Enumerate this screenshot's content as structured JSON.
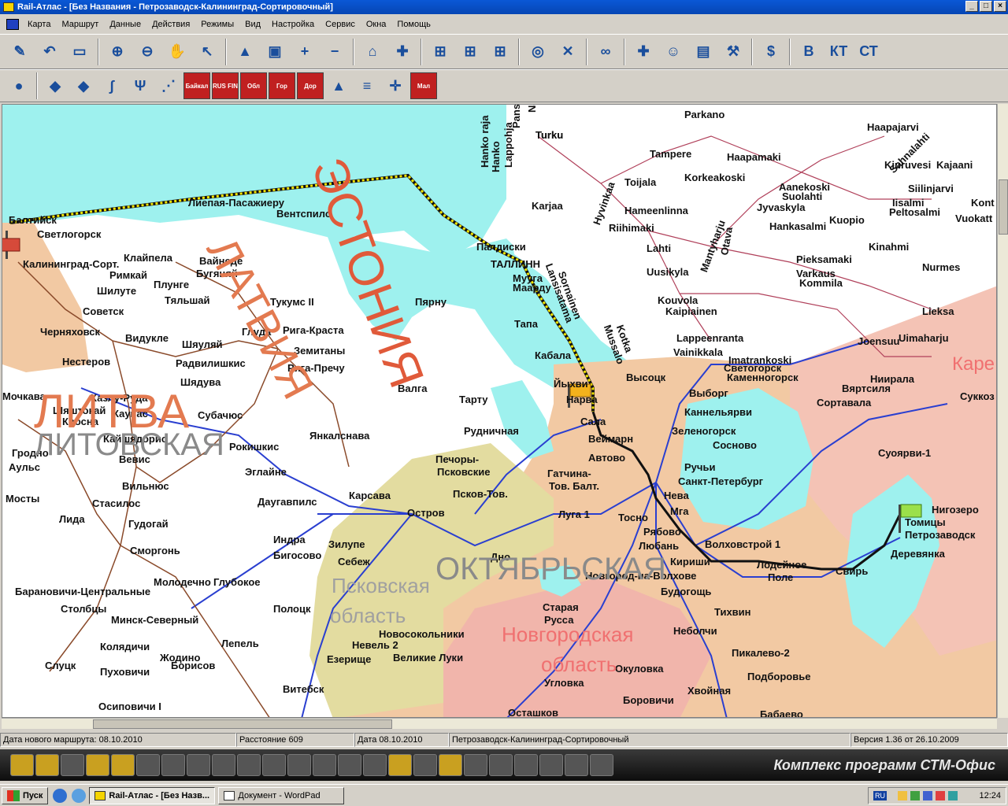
{
  "window": {
    "title": "Rail-Атлас - [Без Названия   -   Петрозаводск-Калининград-Сортировочный]",
    "controls": {
      "minimize": "_",
      "maximize": "□",
      "close": "×"
    }
  },
  "menu": [
    "Карта",
    "Маршрут",
    "Данные",
    "Действия",
    "Режимы",
    "Вид",
    "Настройка",
    "Сервис",
    "Окна",
    "Помощь"
  ],
  "toolbar1": [
    {
      "icon": "edit-pencil-icon",
      "glyph": "✎"
    },
    {
      "icon": "undo-arrow-icon",
      "glyph": "↶"
    },
    {
      "icon": "eraser-icon",
      "glyph": "▭"
    },
    {
      "icon": "zoom-in-icon",
      "glyph": "⊕"
    },
    {
      "icon": "zoom-out-icon",
      "glyph": "⊖"
    },
    {
      "icon": "hand-pan-icon",
      "glyph": "✋"
    },
    {
      "icon": "pointer-arrow-icon",
      "glyph": "↖"
    },
    {
      "icon": "map-layer-icon",
      "glyph": "▲"
    },
    {
      "icon": "map-picture-icon",
      "glyph": "▣"
    },
    {
      "icon": "plus-icon",
      "glyph": "+"
    },
    {
      "icon": "minus-icon",
      "glyph": "−"
    },
    {
      "icon": "train-station-icon",
      "glyph": "⌂"
    },
    {
      "icon": "add-person-icon",
      "glyph": "✚"
    },
    {
      "icon": "railway-1-icon",
      "glyph": "⊞"
    },
    {
      "icon": "railway-2-icon",
      "glyph": "⊞"
    },
    {
      "icon": "railway-3-icon",
      "glyph": "⊞"
    },
    {
      "icon": "target-icon",
      "glyph": "◎"
    },
    {
      "icon": "delete-cross-icon",
      "glyph": "✕"
    },
    {
      "icon": "binoculars-icon",
      "glyph": "∞"
    },
    {
      "icon": "person-move-icon",
      "glyph": "✚"
    },
    {
      "icon": "people-icon",
      "glyph": "☺"
    },
    {
      "icon": "computer-icon",
      "glyph": "▤"
    },
    {
      "icon": "tools-icon",
      "glyph": "⚒"
    },
    {
      "icon": "tariff-icon",
      "glyph": "$"
    },
    {
      "icon": "letter-b-icon",
      "glyph": "В"
    },
    {
      "icon": "letter-kt-icon",
      "glyph": "КТ"
    },
    {
      "icon": "letter-st-icon",
      "glyph": "СТ"
    }
  ],
  "toolbar2": [
    {
      "icon": "globe-icon",
      "glyph": "●",
      "text": ""
    },
    {
      "icon": "region-map-icon",
      "glyph": "◆",
      "text": ""
    },
    {
      "icon": "fed-districts-icon",
      "glyph": "◆",
      "text": ""
    },
    {
      "icon": "rivers-icon",
      "glyph": "∫",
      "text": ""
    },
    {
      "icon": "river-network-icon",
      "glyph": "Ψ",
      "text": ""
    },
    {
      "icon": "border-line-icon",
      "glyph": "⋰",
      "text": ""
    },
    {
      "icon": "baikal-icon",
      "glyph": "",
      "text": "Байкал"
    },
    {
      "icon": "rus-fin-flag-icon",
      "glyph": "",
      "text": "RUS FIN"
    },
    {
      "icon": "oblast-icon",
      "glyph": "",
      "text": "Обл"
    },
    {
      "icon": "cities-icon",
      "glyph": "",
      "text": "Гор"
    },
    {
      "icon": "roads-icon",
      "glyph": "",
      "text": "Дор"
    },
    {
      "icon": "highway-icon",
      "glyph": "▲",
      "text": ""
    },
    {
      "icon": "rails-icon",
      "glyph": "≡",
      "text": ""
    },
    {
      "icon": "junction-icon",
      "glyph": "✛",
      "text": ""
    },
    {
      "icon": "small-stations-icon",
      "glyph": "",
      "text": "Мал"
    }
  ],
  "map": {
    "route_name": "Петрозаводск-Калининград-Сортировочный",
    "region_labels": [
      {
        "text": "ЭСТОНИЯ",
        "color": "#e05a3a"
      },
      {
        "text": "ЛАТВИЯ",
        "color": "#e37a50"
      },
      {
        "text": "ЛИТВА",
        "color": "#e37a50"
      },
      {
        "text": "ЛИТОВСКАЯ",
        "color": "#8a8a8a"
      },
      {
        "text": "ОКТЯБРЬСКАЯ",
        "color": "#8a8a8a"
      },
      {
        "text": "Псковская",
        "color": "#a0a0a0"
      },
      {
        "text": "область",
        "color": "#a0a0a0"
      },
      {
        "text": "Новгородская",
        "color": "#f07070"
      },
      {
        "text": "область",
        "color": "#f07070"
      },
      {
        "text": "Каре",
        "color": "#f07070"
      }
    ],
    "places": [
      "Parkano",
      "Turku",
      "Haapajarvi",
      "Tampere",
      "Haapamaki",
      "Kiuruvesi",
      "Siilinjarvi",
      "Kajaani",
      "Toijala",
      "Korkeakoski",
      "Aanekoski",
      "Suolahti",
      "Jyvaskyla",
      "Iisalmi",
      "Peltosalmi",
      "Kont",
      "Vuokatt",
      "Karjaa",
      "Hameenlinna",
      "Riihimaki",
      "Hankasalmi",
      "Kuopio",
      "Lahti",
      "Kinahmi",
      "Pieksamaki",
      "Uusikyla",
      "Varkaus",
      "Kommila",
      "Nurmes",
      "Kouvola",
      "Kaipiainen",
      "Lieksa",
      "Lappeenranta",
      "Joensuu",
      "Uimaharju",
      "Vainikkala",
      "Imatrankoski",
      "Светогорск",
      "Каменногорск",
      "Высоцк",
      "Ниирала",
      "Вяртсиля",
      "Выборг",
      "Сортавала",
      "Суккоз",
      "Каннельярви",
      "Зеленогорск",
      "Сосново",
      "Суоярви-1",
      "Ручьи",
      "Санкт-Петербург",
      "Нева",
      "Мга",
      "Нигозеро",
      "Томицы",
      "Петрозаводск",
      "Деревянка",
      "Волховстрой 1",
      "Лодейное",
      "Поле",
      "Свирь",
      "Кириши",
      "Рябово",
      "Любань",
      "Новгород-на-Волхове",
      "Будогощь",
      "Тихвин",
      "Неболчи",
      "Пикалево-2",
      "Подборовье",
      "Окуловка",
      "Хвойная",
      "Боровичи",
      "Бабаево",
      "Осташков",
      "Угловка",
      "Тосно",
      "Луга 1",
      "Гатчина-",
      "Тов. Балт.",
      "Автово",
      "Веймарн",
      "Сала",
      "Нарва",
      "Йыхви",
      "Кабала",
      "Тапа",
      "Маарду",
      "Мууга",
      "ТАЛЛИНН",
      "Палдиски",
      "Пярну",
      "Тарту",
      "Валга",
      "Рудничная",
      "Печоры-",
      "Псковские",
      "Псков-Тов.",
      "Остров",
      "Карсава",
      "Дно",
      "Старая",
      "Русса",
      "Новосокольники",
      "Великие Луки",
      "Невель 2",
      "Езерище",
      "Витебск",
      "Полоцк",
      "Лепель",
      "Борисов",
      "Жодино",
      "Пуховичи",
      "Осиповичи I",
      "Слуцк",
      "Колядичи",
      "Столбцы",
      "Минск-Северный",
      "Молодечно",
      "Глубокое",
      "Барановичи-Центральные",
      "Лида",
      "Сморгонь",
      "Гудогай",
      "Вильнюс",
      "Стасилос",
      "Индра",
      "Бигосово",
      "Зилупе",
      "Себеж",
      "Даугавпилс",
      "Эглайне",
      "Рокишкис",
      "Янкалснава",
      "Субачюс",
      "Шядува",
      "Радвилишкис",
      "Шяуляй",
      "Рига-Краста",
      "Земитаны",
      "Рига-Пречу",
      "Глуда",
      "Тукумс II",
      "Вентспилс",
      "Лиепая-Пасажиеру",
      "Вайнеде",
      "Бугяняй",
      "Плунге",
      "Тяльшай",
      "Клайпела",
      "Римкай",
      "Шилуте",
      "Советск",
      "Черняховск",
      "Нестеров",
      "Видукле",
      "Калининград-Сорт.",
      "Светлогорск",
      "Балтийск",
      "Мочкава",
      "Казлу-Руда",
      "Шяштокай",
      "Каунас",
      "Кросна",
      "Кайшядорис",
      "Вевис",
      "Гродно",
      "Аульс",
      "Мосты",
      "Hanko raja",
      "Hanko",
      "Lappohja",
      "Pansio",
      "Turku",
      "Naantali",
      "Hyvinkaa",
      "Sornainen",
      "Lansisatama",
      "Mantyharju",
      "Otava",
      "Kotka",
      "Mussalo",
      "Sahnalahti"
    ]
  },
  "status": {
    "route_date": "Дата нового маршрута: 08.10.2010",
    "distance": "Расстояние 609",
    "date": "Дата 08.10.2010",
    "route": "Петрозаводск-Калининград-Сортировочный",
    "version": "Версия 1.36 от 26.10.2009"
  },
  "bottombar": {
    "tagline": "Комплекс программ СТМ-Офис",
    "button_count": 24
  },
  "taskbar": {
    "start": "Пуск",
    "tasks": [
      {
        "label": "Rail-Атлас - [Без Назв...",
        "active": true
      },
      {
        "label": "Документ - WordPad",
        "active": false
      }
    ],
    "lang": "RU",
    "clock": "12:24"
  },
  "colors": {
    "sea": "#9ef1ee",
    "foreign_land": "#ffffff",
    "october_railway": "#f2c9a3",
    "novgorod": "#f1b5ab",
    "karelia": "#f4c3b5",
    "pskov": "#e3dca0",
    "railway_lines": "#2a3fd0",
    "route_line": "#111111",
    "route_sea_line": "#f3e600",
    "titlebar": "#0a58d6"
  }
}
